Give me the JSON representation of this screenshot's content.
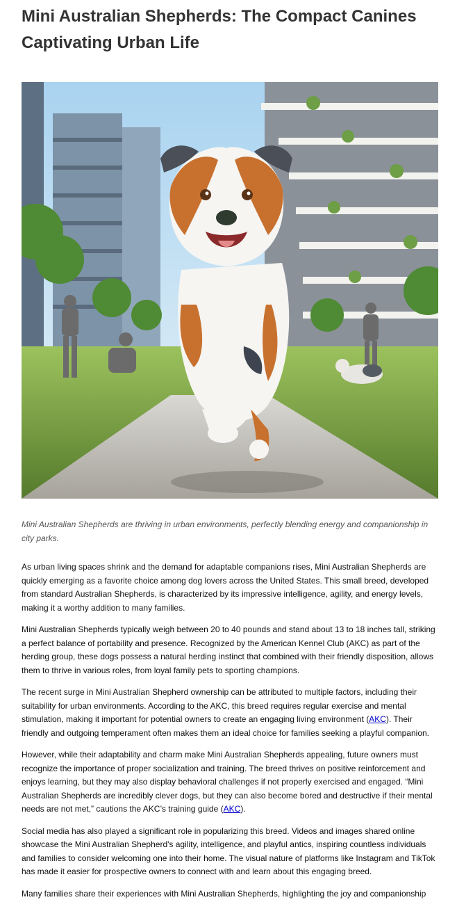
{
  "article": {
    "title": "Mini Australian Shepherds: The Compact Canines Captivating Urban Life",
    "caption": "Mini Australian Shepherds are thriving in urban environments, perfectly blending energy and companionship in city parks.",
    "p1": "As urban living spaces shrink and the demand for adaptable companions rises, Mini Australian Shepherds are quickly emerging as a favorite choice among dog lovers across the United States. This small breed, developed from standard Australian Shepherds, is characterized by its impressive intelligence, agility, and energy levels, making it a worthy addition to many families.",
    "p2": "Mini Australian Shepherds typically weigh between 20 to 40 pounds and stand about 13 to 18 inches tall, striking a perfect balance of portability and presence. Recognized by the American Kennel Club (AKC) as part of the herding group, these dogs possess a natural herding instinct that combined with their friendly disposition, allows them to thrive in various roles, from loyal family pets to sporting champions.",
    "p3_a": "The recent surge in Mini Australian Shepherd ownership can be attributed to multiple factors, including their suitability for urban environments. According to the AKC, this breed requires regular exercise and mental stimulation, making it important for potential owners to create an engaging living environment (",
    "p3_link": "AKC",
    "p3_b": "). Their friendly and outgoing temperament often makes them an ideal choice for families seeking a playful companion.",
    "p4_a": "However, while their adaptability and charm make Mini Australian Shepherds appealing, future owners must recognize the importance of proper socialization and training. The breed thrives on positive reinforcement and enjoys learning, but they may also display behavioral challenges if not properly exercised and engaged. “Mini Australian Shepherds are incredibly clever dogs, but they can also become bored and destructive if their mental needs are not met,” cautions the AKC’s training guide (",
    "p4_link": "AKC",
    "p4_b": ").",
    "p5": "Social media has also played a significant role in popularizing this breed. Videos and images shared online showcase the Mini Australian Shepherd's agility, intelligence, and playful antics, inspiring countless individuals and families to consider welcoming one into their home. The visual nature of platforms like Instagram and TikTok has made it easier for prospective owners to connect with and learn about this engaging breed.",
    "p6": "Many families share their experiences with Mini Australian Shepherds, highlighting the joy and companionship"
  }
}
